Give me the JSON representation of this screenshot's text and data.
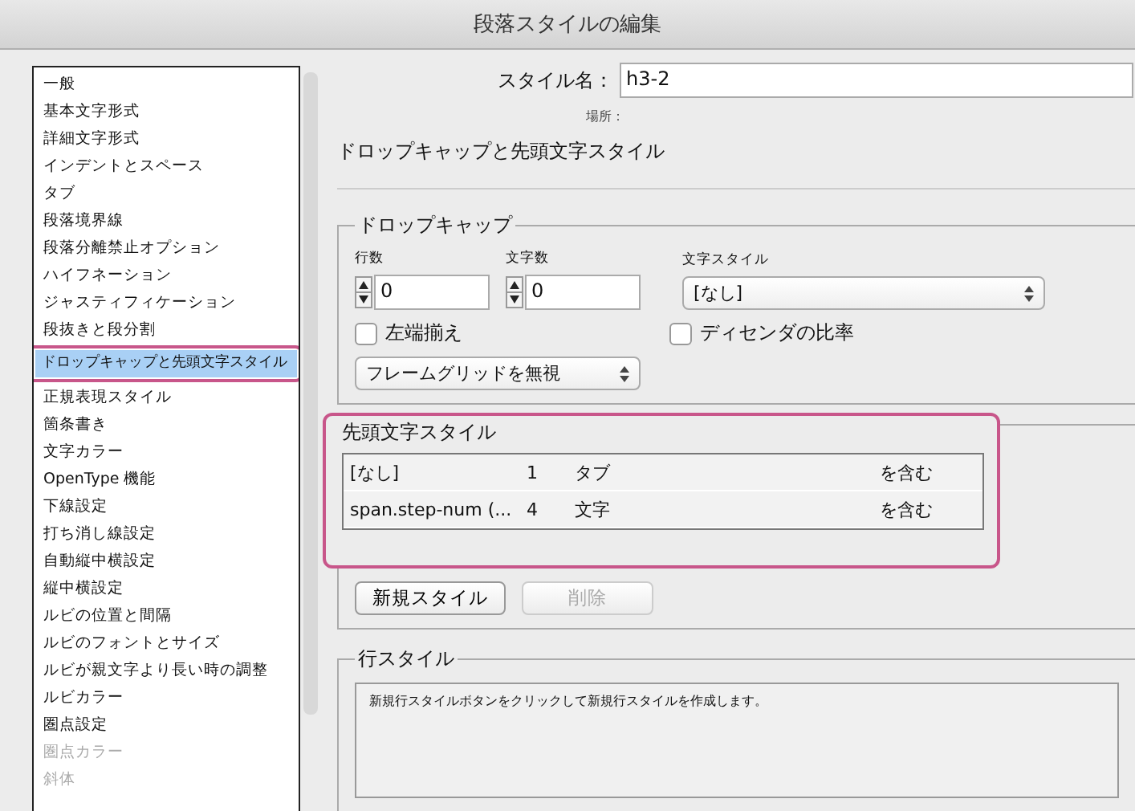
{
  "window": {
    "title": "段落スタイルの編集"
  },
  "sidebar": {
    "items": [
      {
        "label": "一般",
        "selected": false,
        "dimmed": false
      },
      {
        "label": "基本文字形式",
        "selected": false,
        "dimmed": false
      },
      {
        "label": "詳細文字形式",
        "selected": false,
        "dimmed": false
      },
      {
        "label": "インデントとスペース",
        "selected": false,
        "dimmed": false
      },
      {
        "label": "タブ",
        "selected": false,
        "dimmed": false
      },
      {
        "label": "段落境界線",
        "selected": false,
        "dimmed": false
      },
      {
        "label": "段落分離禁止オプション",
        "selected": false,
        "dimmed": false
      },
      {
        "label": "ハイフネーション",
        "selected": false,
        "dimmed": false
      },
      {
        "label": "ジャスティフィケーション",
        "selected": false,
        "dimmed": false
      },
      {
        "label": "段抜きと段分割",
        "selected": false,
        "dimmed": false
      },
      {
        "label": "ドロップキャップと先頭文字スタイル",
        "selected": true,
        "dimmed": false
      },
      {
        "label": "正規表現スタイル",
        "selected": false,
        "dimmed": false
      },
      {
        "label": "箇条書き",
        "selected": false,
        "dimmed": false
      },
      {
        "label": "文字カラー",
        "selected": false,
        "dimmed": false
      },
      {
        "label": "OpenType 機能",
        "selected": false,
        "dimmed": false
      },
      {
        "label": "下線設定",
        "selected": false,
        "dimmed": false
      },
      {
        "label": "打ち消し線設定",
        "selected": false,
        "dimmed": false
      },
      {
        "label": "自動縦中横設定",
        "selected": false,
        "dimmed": false
      },
      {
        "label": "縦中横設定",
        "selected": false,
        "dimmed": false
      },
      {
        "label": "ルビの位置と間隔",
        "selected": false,
        "dimmed": false
      },
      {
        "label": "ルビのフォントとサイズ",
        "selected": false,
        "dimmed": false
      },
      {
        "label": "ルビが親文字より長い時の調整",
        "selected": false,
        "dimmed": false
      },
      {
        "label": "ルビカラー",
        "selected": false,
        "dimmed": false
      },
      {
        "label": "圏点設定",
        "selected": false,
        "dimmed": false
      },
      {
        "label": "圏点カラー",
        "selected": false,
        "dimmed": true
      },
      {
        "label": "斜体",
        "selected": false,
        "dimmed": true
      }
    ]
  },
  "style_name": {
    "label": "スタイル名：",
    "value": "h3-2"
  },
  "location": {
    "label": "場所："
  },
  "section_title": "ドロップキャップと先頭文字スタイル",
  "drop_cap": {
    "title": "ドロップキャップ",
    "lines_label": "行数",
    "lines": "0",
    "chars_label": "文字数",
    "chars": "0",
    "char_style_label": "文字スタイル",
    "char_style": "[なし]",
    "align_left": {
      "label": "左端揃え",
      "checked": false
    },
    "descender": {
      "label": "ディセンダの比率",
      "checked": false
    },
    "grid": "フレームグリッドを無視"
  },
  "nested_styles": {
    "title": "先頭文字スタイル",
    "rows": [
      {
        "style": "[なし]",
        "count": "1",
        "unit": "タブ",
        "mode": "を含む"
      },
      {
        "style": "span.step-num (...",
        "count": "4",
        "unit": "文字",
        "mode": "を含む"
      }
    ],
    "buttons": [
      {
        "label": "新規スタイル",
        "disabled": false
      },
      {
        "label": "削除",
        "disabled": true
      }
    ]
  },
  "line_styles": {
    "title": "行スタイル",
    "message": "新規行スタイルボタンをクリックして新規行スタイルを作成します。"
  }
}
